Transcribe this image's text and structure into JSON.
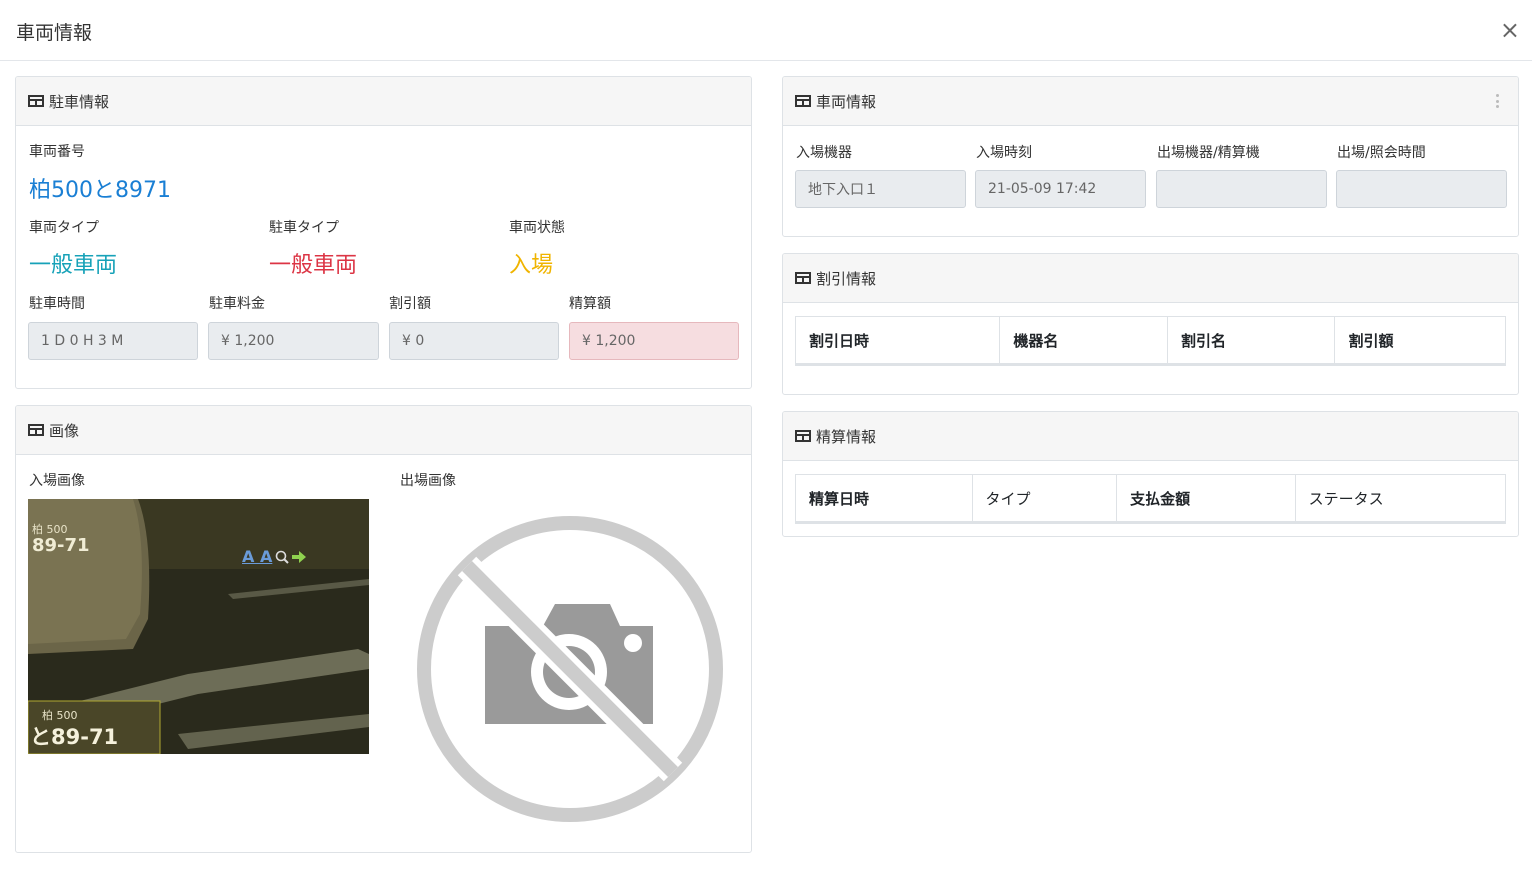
{
  "modal": {
    "title": "車両情報",
    "close": "×"
  },
  "parking": {
    "header": "駐車情報",
    "plate_label": "車両番号",
    "plate_value": "柏500と8971",
    "vehicle_type_label": "車両タイプ",
    "vehicle_type_value": "一般車両",
    "parking_type_label": "駐車タイプ",
    "parking_type_value": "一般車両",
    "state_label": "車両状態",
    "state_value": "入場",
    "duration_label": "駐車時間",
    "duration_value": "1 D 0 H 3 M",
    "fee_label": "駐車料金",
    "fee_value": "¥ 1,200",
    "discount_label": "割引額",
    "discount_value": "¥ 0",
    "settle_label": "精算額",
    "settle_value": "¥ 1,200"
  },
  "image": {
    "header": "画像",
    "entry_label": "入場画像",
    "exit_label": "出場画像",
    "plate_overlay_top": "柏 500",
    "plate_overlay_main": "89-71",
    "plate_crop_top": "柏 500",
    "plate_crop_main": "と89-71",
    "overlay_icons": "A A"
  },
  "vehicle": {
    "header": "車両情報",
    "entry_device_label": "入場機器",
    "entry_device_value": "地下入口１",
    "entry_time_label": "入場時刻",
    "entry_time_value": "21-05-09 17:42",
    "exit_device_label": "出場機器/精算機",
    "exit_device_value": "",
    "exit_time_label": "出場/照会時間",
    "exit_time_value": ""
  },
  "discount": {
    "header": "割引情報",
    "columns": [
      "割引日時",
      "機器名",
      "割引名",
      "割引額"
    ]
  },
  "settlement": {
    "header": "精算情報",
    "columns": [
      "精算日時",
      "タイプ",
      "支払金額",
      "ステータス"
    ]
  },
  "colors": {
    "plate": "#1a7fd4",
    "vehicle_type": "#17a2b8",
    "parking_type": "#dc3545",
    "state": "#f0b400"
  }
}
